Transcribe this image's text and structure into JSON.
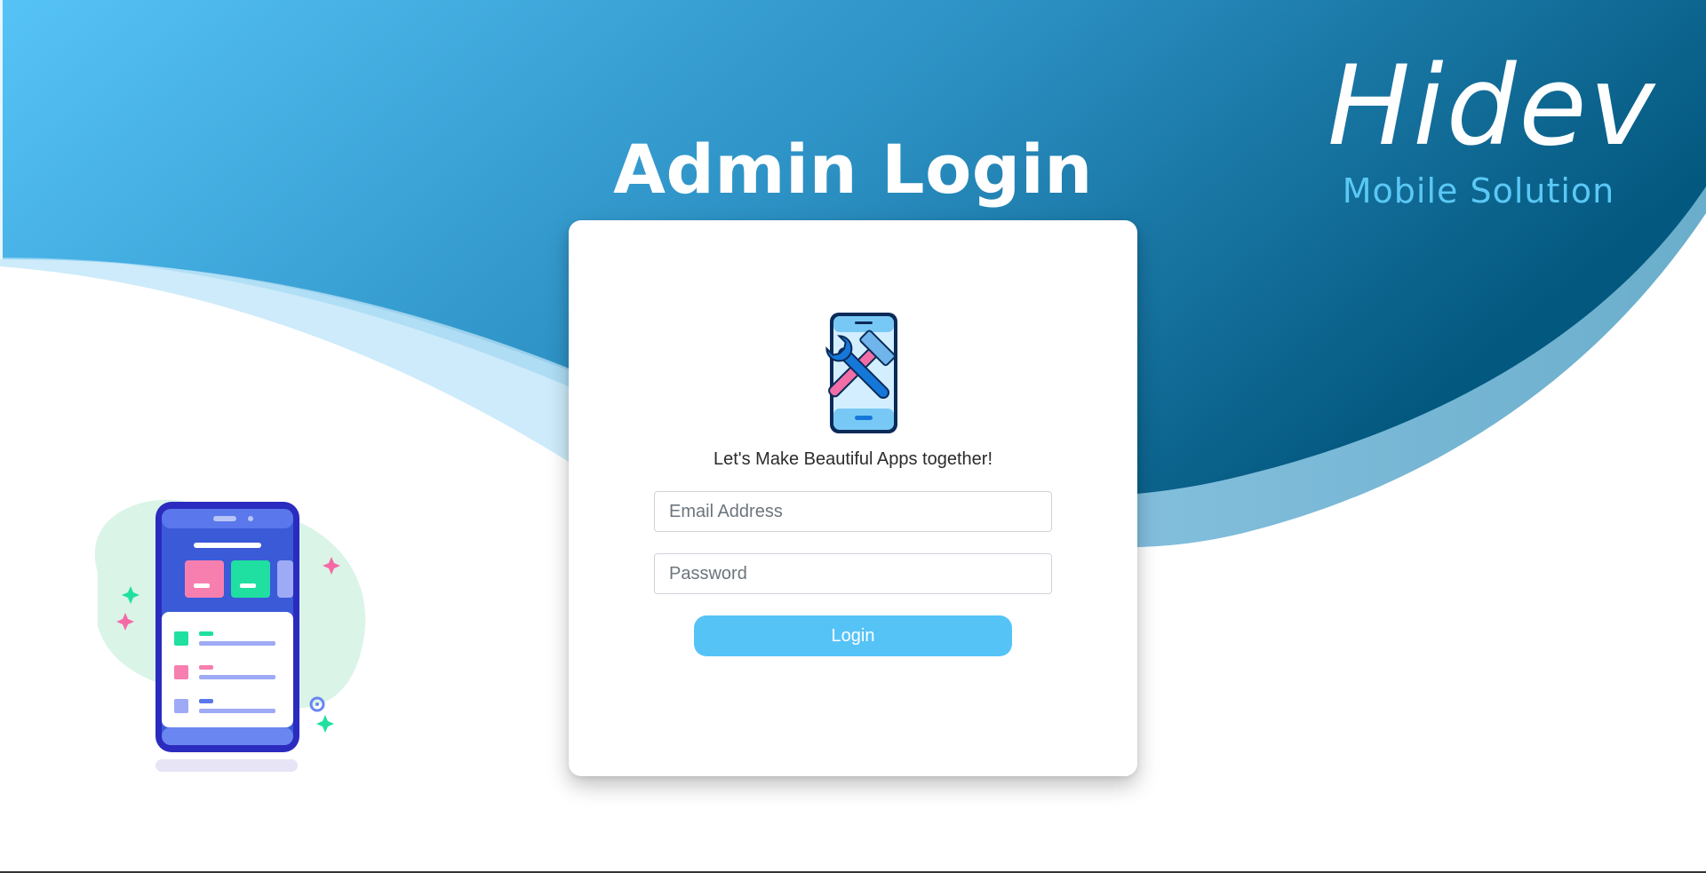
{
  "header": {
    "title": "Admin Login"
  },
  "brand": {
    "name": "Hidev",
    "tagline": "Mobile Solution"
  },
  "login_form": {
    "tagline": "Let's Make Beautiful Apps together!",
    "email": {
      "placeholder": "Email Address",
      "value": ""
    },
    "password": {
      "placeholder": "Password",
      "value": ""
    },
    "submit_label": "Login"
  },
  "colors": {
    "gradient_start": "#56c3f7",
    "gradient_end": "#03587f",
    "accent": "#56c3f7",
    "tagline_accent": "#5bc8f5"
  },
  "icons": {
    "card_logo": "phone-tools-icon",
    "illustration": "mobile-app-illustration"
  }
}
